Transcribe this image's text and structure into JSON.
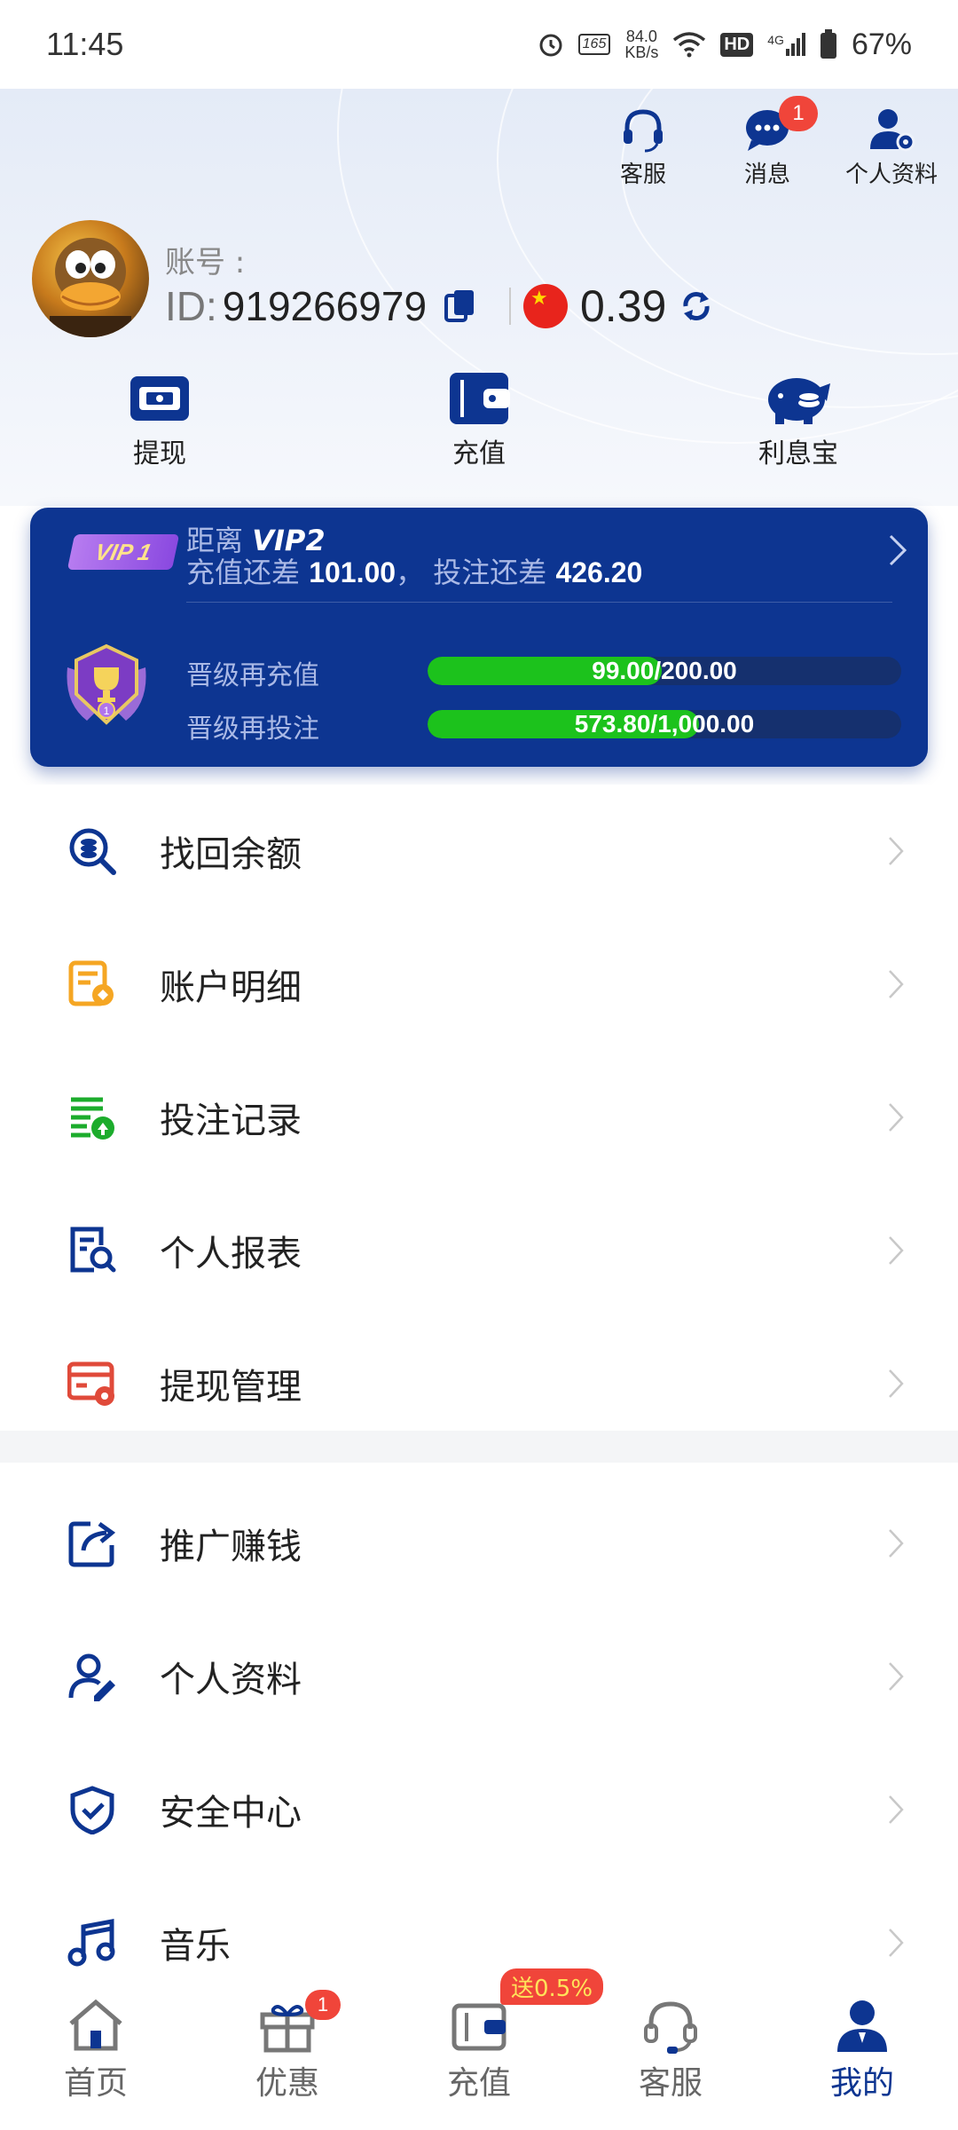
{
  "status_bar": {
    "time": "11:45",
    "net_speed_value": "84.0",
    "net_speed_unit": "KB/s",
    "refresh": "165",
    "hd": "HD",
    "signal": "4G",
    "battery": "67%"
  },
  "header": {
    "actions": [
      {
        "label": "客服",
        "icon": "headset-icon"
      },
      {
        "label": "消息",
        "icon": "chat-bubble-icon",
        "badge": "1"
      },
      {
        "label": "个人资料",
        "icon": "user-settings-icon"
      }
    ],
    "account_label": "账号 :",
    "id_prefix": "ID:",
    "account_id": "919266979",
    "balance": "0.39",
    "quick_actions": [
      {
        "label": "提现",
        "icon": "withdraw-icon"
      },
      {
        "label": "充值",
        "icon": "wallet-icon"
      },
      {
        "label": "利息宝",
        "icon": "piggy-bank-icon"
      }
    ]
  },
  "vip": {
    "badge": "VIP 1",
    "distance_label": "距离",
    "next_level": "VIP2",
    "recharge_label": "充值还差",
    "recharge_remaining": "101.00",
    "separator": "，",
    "bet_label": "投注还差",
    "bet_remaining": "426.20",
    "rows": [
      {
        "label": "晋级再充值",
        "current": "99.00",
        "total": "/200.00",
        "progress": 0.495
      },
      {
        "label": "晋级再投注",
        "current": "573.80",
        "total": "/1,000.00",
        "progress": 0.5738
      }
    ]
  },
  "menu_group_1": [
    {
      "label": "找回余额",
      "icon": "recover-balance-icon",
      "color": "#0d3591"
    },
    {
      "label": "账户明细",
      "icon": "account-detail-icon",
      "color": "#f5a623"
    },
    {
      "label": "投注记录",
      "icon": "bet-record-icon",
      "color": "#1cac2c"
    },
    {
      "label": "个人报表",
      "icon": "report-search-icon",
      "color": "#0d3591"
    },
    {
      "label": "提现管理",
      "icon": "withdraw-manage-icon",
      "color": "#e04a3a"
    }
  ],
  "menu_group_2": [
    {
      "label": "推广赚钱",
      "icon": "share-icon",
      "color": "#0d3591"
    },
    {
      "label": "个人资料",
      "icon": "profile-edit-icon",
      "color": "#0d3591"
    },
    {
      "label": "安全中心",
      "icon": "shield-check-icon",
      "color": "#0d3591"
    },
    {
      "label": "音乐",
      "icon": "music-note-icon",
      "color": "#0d3591"
    }
  ],
  "bottom_nav": [
    {
      "label": "首页",
      "icon": "home-icon"
    },
    {
      "label": "优惠",
      "icon": "gift-icon",
      "badge": "1"
    },
    {
      "label": "充值",
      "icon": "wallet-icon",
      "promo": "送0.5%"
    },
    {
      "label": "客服",
      "icon": "headset-icon"
    },
    {
      "label": "我的",
      "icon": "user-icon",
      "active": true
    }
  ],
  "colors": {
    "primary": "#0d3591",
    "progress": "#1cc21c",
    "badge": "#f0453a"
  }
}
